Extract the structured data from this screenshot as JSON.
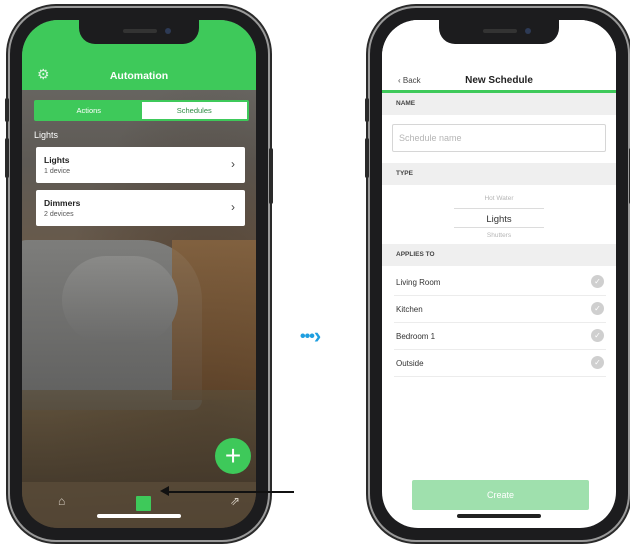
{
  "left_screen": {
    "header_title": "Automation",
    "settings_icon": "gear-icon",
    "segment": {
      "actions": "Actions",
      "schedules": "Schedules",
      "selected": "Schedules"
    },
    "section_label": "Lights",
    "cards": [
      {
        "title": "Lights",
        "subtitle": "1 device",
        "chevron": "›"
      },
      {
        "title": "Dimmers",
        "subtitle": "2 devices",
        "chevron": "›"
      }
    ],
    "fab_label": "+",
    "tabbar": {
      "home_icon": "home-icon",
      "automation_icon": "automation-icon",
      "share_icon": "share-icon"
    },
    "accent_color": "#3ec95a"
  },
  "right_screen": {
    "back_label": "‹ Back",
    "title": "New Schedule",
    "name_section": "NAME",
    "name_placeholder": "Schedule name",
    "type_section": "TYPE",
    "type_picker": {
      "above": "Hot Water",
      "selected": "Lights",
      "below": "Shutters"
    },
    "applies_section": "APPLIES TO",
    "rooms": [
      "Living Room",
      "Kitchen",
      "Bedroom 1",
      "Outside"
    ],
    "create_label": "Create"
  }
}
